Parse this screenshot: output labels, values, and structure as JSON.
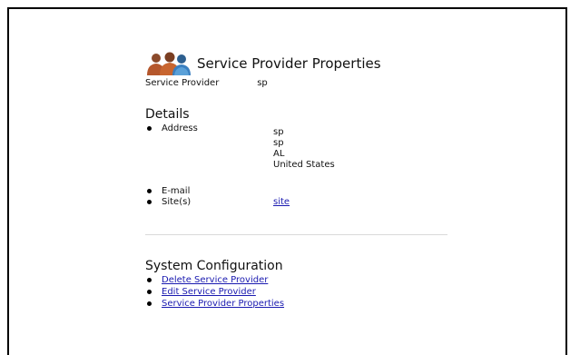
{
  "header": {
    "title": "Service Provider Properties",
    "icon": "people-icon"
  },
  "service_provider": {
    "label": "Service Provider",
    "value": "sp"
  },
  "details": {
    "heading": "Details",
    "address_label": "Address",
    "address_lines": [
      "sp",
      "sp",
      "AL",
      "United States"
    ],
    "email_label": "E-mail",
    "email_value": "",
    "sites_label": "Site(s)",
    "sites_link": "site"
  },
  "system_configuration": {
    "heading": "System Configuration",
    "links": [
      "Delete Service Provider",
      "Edit Service Provider",
      "Service Provider Properties"
    ]
  },
  "colors": {
    "link": "#1a1ab0",
    "divider": "#d9d9d9",
    "icon_front": "#3a7fc0",
    "icon_back": "#a0522d"
  }
}
